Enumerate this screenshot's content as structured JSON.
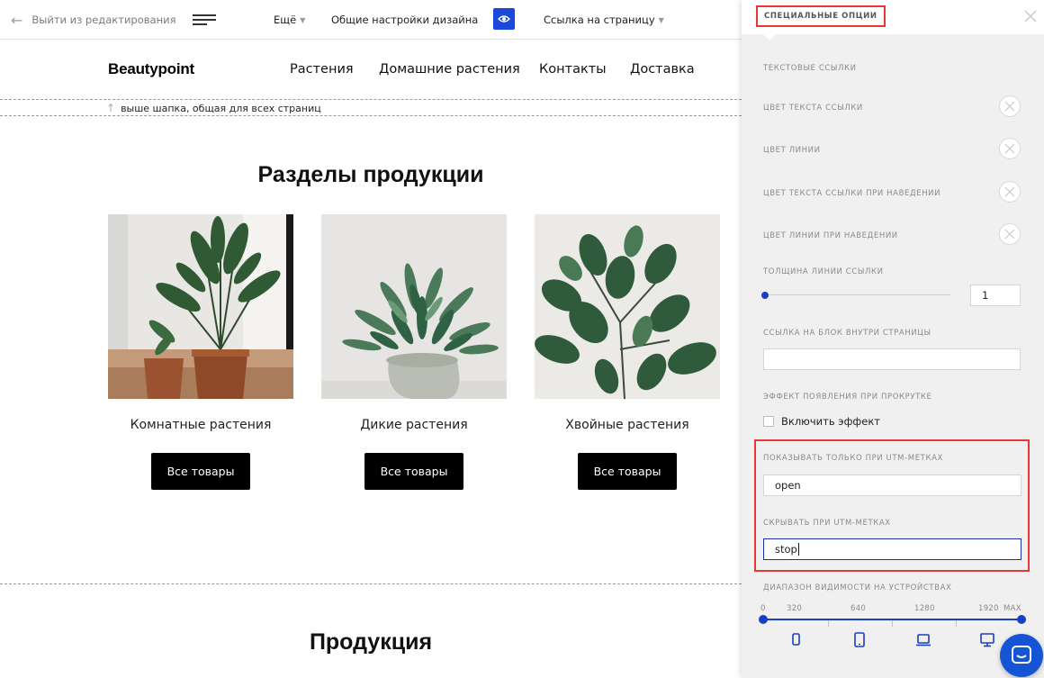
{
  "toolbar": {
    "exit_label": "Выйти из редактирования",
    "more_label": "Ещё",
    "design_label": "Общие настройки дизайна",
    "page_link_label": "Ссылка на страницу"
  },
  "site": {
    "logo": "Beautypoint",
    "nav": [
      "Растения",
      "Домашние растения",
      "Контакты",
      "Доставка"
    ],
    "header_note": "выше шапка, общая для всех страниц",
    "section_title": "Разделы продукции",
    "cards": [
      {
        "caption": "Комнатные растения",
        "button": "Все товары"
      },
      {
        "caption": "Дикие растения",
        "button": "Все товары"
      },
      {
        "caption": "Хвойные растения",
        "button": "Все товары"
      }
    ],
    "products_title": "Продукция"
  },
  "panel": {
    "tab_active": "СПЕЦИАЛЬНЫЕ ОПЦИИ",
    "text_links": "ТЕКСТОВЫЕ ССЫЛКИ",
    "link_color": "ЦВЕТ ТЕКСТА ССЫЛКИ",
    "line_color": "ЦВЕТ ЛИНИИ",
    "link_hover_color": "ЦВЕТ ТЕКСТА ССЫЛКИ ПРИ НАВЕДЕНИИ",
    "line_hover_color": "ЦВЕТ ЛИНИИ ПРИ НАВЕДЕНИИ",
    "line_width_label": "ТОЛЩИНА ЛИНИИ ССЫЛКИ",
    "line_width_value": "1",
    "anchor_label": "ССЫЛКА НА БЛОК ВНУТРИ СТРАНИЦЫ",
    "anchor_value": "",
    "scroll_effect_label": "ЭФФЕКТ ПОЯВЛЕНИЯ ПРИ ПРОКРУТКЕ",
    "scroll_effect_checkbox": "Включить эффект",
    "utm_show_label": "ПОКАЗЫВАТЬ ТОЛЬКО ПРИ UTM-МЕТКАХ",
    "utm_show_value": "open",
    "utm_hide_label": "СКРЫВАТЬ ПРИ UTM-МЕТКАХ",
    "utm_hide_value": "stop",
    "device_range_label": "ДИАПАЗОН ВИДИМОСТИ НА УСТРОЙСТВАХ",
    "device_range_ticks": [
      "0",
      "320",
      "640",
      "1280",
      "1920",
      "MAX"
    ]
  },
  "colors": {
    "accent_blue": "#1a48d8",
    "highlight_red": "#e53935",
    "chat_blue": "#1654d6"
  }
}
